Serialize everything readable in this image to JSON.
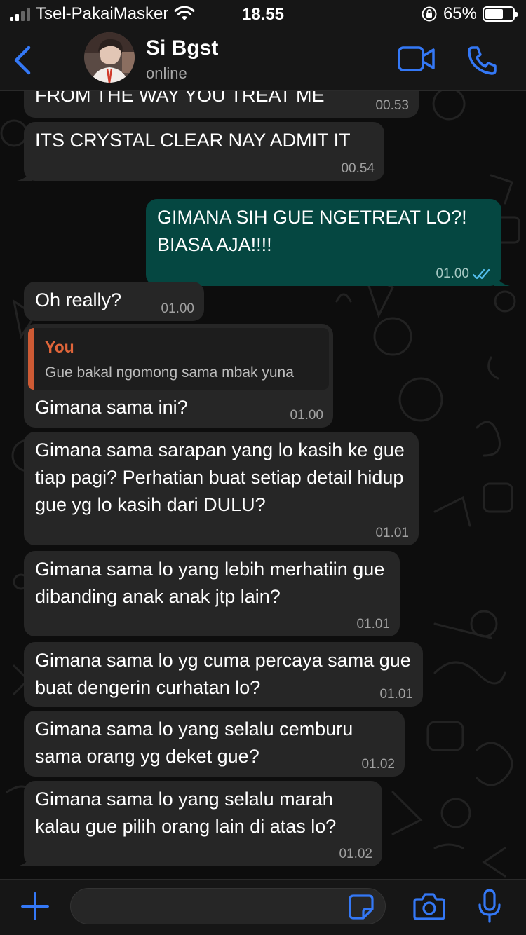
{
  "status_bar": {
    "carrier": "Tsel-PakaiMasker",
    "time": "18.55",
    "battery": "65%",
    "battery_level": 0.65
  },
  "header": {
    "contact_name": "Si Bgst",
    "contact_status": "online"
  },
  "messages": [
    {
      "dir": "in",
      "text": "FROM THE WAY YOU TREAT ME",
      "time": "00.53"
    },
    {
      "dir": "in",
      "text": "ITS CRYSTAL CLEAR NAY ADMIT IT",
      "time": "00.54"
    },
    {
      "dir": "out",
      "text": "GIMANA SIH GUE NGETREAT LO?!\nBIASA AJA!!!!",
      "time": "01.00",
      "read": true
    },
    {
      "dir": "in",
      "text": "Oh really?",
      "time": "01.00"
    },
    {
      "dir": "in",
      "reply_author": "You",
      "reply_text": "Gue bakal ngomong sama mbak yuna",
      "text": "Gimana sama ini?",
      "time": "01.00"
    },
    {
      "dir": "in",
      "text": "Gimana sama sarapan yang lo kasih ke gue tiap pagi? Perhatian buat setiap detail hidup gue yg lo kasih dari DULU?",
      "time": "01.01"
    },
    {
      "dir": "in",
      "text": "Gimana sama lo yang lebih merhatiin gue dibanding anak anak jtp lain?",
      "time": "01.01"
    },
    {
      "dir": "in",
      "text": "Gimana sama lo yg cuma percaya sama gue buat dengerin curhatan lo?",
      "time": "01.01"
    },
    {
      "dir": "in",
      "text": "Gimana sama lo yang selalu cemburu sama orang yg deket gue?",
      "time": "01.02"
    },
    {
      "dir": "in",
      "text": "Gimana sama lo yang selalu marah kalau gue pilih orang lain di atas lo?",
      "time": "01.02"
    }
  ],
  "input": {
    "placeholder": ""
  },
  "colors": {
    "accent": "#3478f6",
    "incoming_bubble": "#262626",
    "outgoing_bubble": "#054741",
    "quote_accent": "#e0653a",
    "read_ticks": "#53bdeb"
  },
  "icons": [
    "back-chevron-icon",
    "video-call-icon",
    "phone-icon",
    "plus-icon",
    "sticker-icon",
    "camera-icon",
    "microphone-icon",
    "double-check-icon",
    "wifi-icon",
    "orientation-lock-icon",
    "battery-icon"
  ]
}
